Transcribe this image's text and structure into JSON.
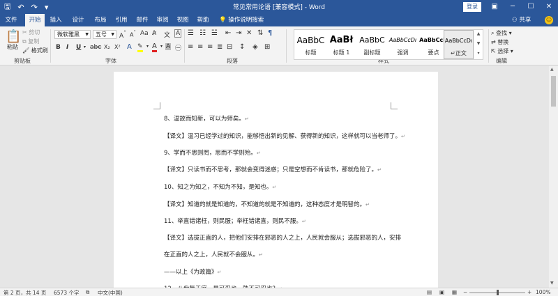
{
  "titlebar": {
    "title": "常见常用论语 [兼容模式] - Word",
    "login_label": "登录"
  },
  "tabs": [
    {
      "label": "文件",
      "active": false
    },
    {
      "label": "开始",
      "active": true
    },
    {
      "label": "插入",
      "active": false
    },
    {
      "label": "设计",
      "active": false
    },
    {
      "label": "布局",
      "active": false
    },
    {
      "label": "引用",
      "active": false
    },
    {
      "label": "邮件",
      "active": false
    },
    {
      "label": "审阅",
      "active": false
    },
    {
      "label": "视图",
      "active": false
    },
    {
      "label": "帮助",
      "active": false
    }
  ],
  "tell_me": "操作说明搜索",
  "share_label": "共享",
  "ribbon": {
    "clipboard": {
      "paste": "粘贴",
      "cut": "剪切",
      "copy": "复制",
      "format_painter": "格式刷",
      "label": "剪贴板"
    },
    "font": {
      "name": "微软雅黑",
      "size": "五号",
      "label": "字体"
    },
    "paragraph": {
      "label": "段落"
    },
    "styles": {
      "label": "样式",
      "items": [
        {
          "sample": "AaBbC",
          "name": "标题"
        },
        {
          "sample": "AaBł",
          "name": "标题 1"
        },
        {
          "sample": "AaBbC",
          "name": "副标题"
        },
        {
          "sample": "AaBbCcDı",
          "name": "强调"
        },
        {
          "sample": "AaBbCcD",
          "name": "要点"
        },
        {
          "sample": "AaBbCcDı",
          "name": "↵正文"
        }
      ]
    },
    "editing": {
      "find": "查找",
      "replace": "替换",
      "select": "选择",
      "label": "编辑"
    }
  },
  "document": {
    "paragraphs": [
      "8、温故而知新，可以为师矣。",
      "【译文】温习已经学过的知识，能够悟出新的见解、获得新的知识，这样就可以当老师了。",
      "9、学而不思则罔，思而不学则殆。",
      "【译文】只读书而不思考，那就会变得迷惑；只是空想而不肯读书，那就危险了。",
      "10、知之为知之，不知为不知，是知也。",
      "【译文】知道的就是知道的，不知道的就是不知道的，这种态度才是明智的。",
      "11、举直错诸枉，则民服；举枉错诸直，则民不服。",
      "【译文】选拔正直的人，把他们安排在邪恶的人之上，人民就会服从；选拔邪恶的人，安排",
      "在正直的人之上，人民就不会服从。",
      "——以上《为政篇》",
      "12、八佾舞于庭，是可忍也，孰不可忍也？"
    ]
  },
  "statusbar": {
    "page": "第 2 页，共 14 页",
    "words": "6573 个字",
    "language": "中文(中国)",
    "zoom": "100%"
  }
}
